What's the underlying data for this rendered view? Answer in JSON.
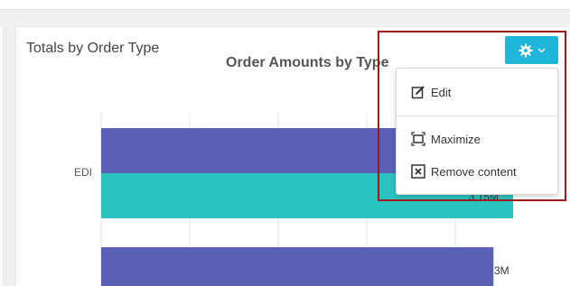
{
  "card": {
    "title": "Totals by Order Type"
  },
  "settings_menu": {
    "button_icon": "gear-icon",
    "items": [
      {
        "label": "Edit",
        "icon": "edit-icon"
      },
      {
        "label": "Maximize",
        "icon": "maximize-icon"
      },
      {
        "label": "Remove content",
        "icon": "close-box-icon"
      }
    ]
  },
  "colors": {
    "accent": "#1fb6d9",
    "series_1": "#5b5fb5",
    "series_2": "#2bc3c0",
    "highlight": "#a01818"
  },
  "chart_data": {
    "type": "bar",
    "orientation": "horizontal",
    "title": "Order Amounts by Type",
    "categories": [
      "EDI",
      ""
    ],
    "series": [
      {
        "values": [
          null,
          3.0
        ]
      },
      {
        "values": [
          3.15,
          null
        ]
      }
    ],
    "data_labels": [
      "3.15M",
      "3M"
    ],
    "grid": true
  }
}
